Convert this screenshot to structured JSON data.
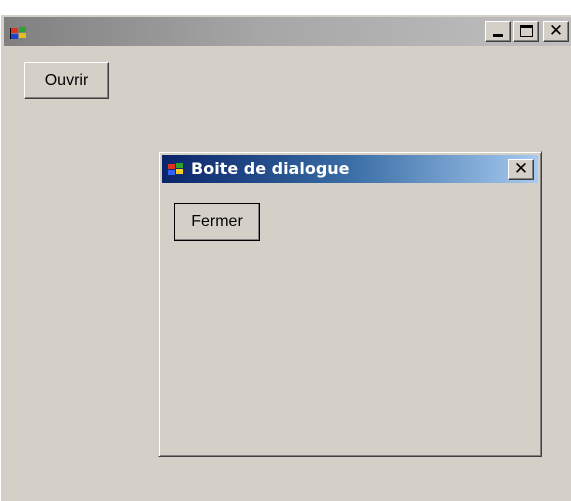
{
  "main_window": {
    "title": "",
    "caption_buttons": {
      "minimize_icon": "minimize-icon",
      "maximize_icon": "maximize-icon",
      "close_icon": "close-icon",
      "close_glyph": "✕"
    },
    "open_button_label": "Ouvrir"
  },
  "dialog": {
    "title": "Boite de dialogue",
    "close_glyph": "✕",
    "close_button_label": "Fermer"
  },
  "colors": {
    "face": "#d4d0c8",
    "active_title_start": "#0a246a",
    "active_title_end": "#a6caf0",
    "inactive_title_start": "#808080",
    "inactive_title_end": "#c0c0c0"
  }
}
